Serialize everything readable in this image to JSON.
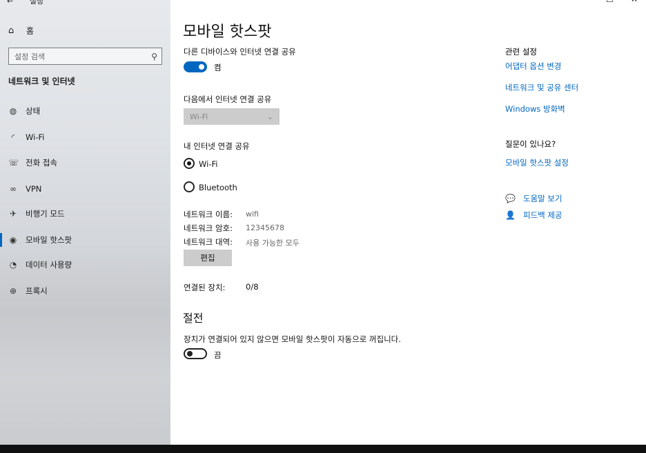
{
  "window": {
    "back_arrow": "←",
    "title": "설정",
    "controls": {
      "minimize": "—",
      "maximize": "☐",
      "close": "✕"
    }
  },
  "sidebar": {
    "home": {
      "icon": "home-icon",
      "label": "홈"
    },
    "search_placeholder": "설정 검색",
    "section_title": "네트워크 및 인터넷",
    "items": [
      {
        "icon": "globe-status-icon",
        "label": "상태"
      },
      {
        "icon": "wifi-icon",
        "label": "Wi-Fi"
      },
      {
        "icon": "dialup-icon",
        "label": "전화 접속"
      },
      {
        "icon": "vpn-icon",
        "label": "VPN"
      },
      {
        "icon": "airplane-icon",
        "label": "비행기 모드"
      },
      {
        "icon": "hotspot-icon",
        "label": "모바일 핫스팟",
        "active": true
      },
      {
        "icon": "data-usage-icon",
        "label": "데이터 사용량"
      },
      {
        "icon": "proxy-globe-icon",
        "label": "프록시"
      }
    ]
  },
  "main": {
    "title": "모바일 핫스팟",
    "share_label": "다른 디바이스와 인터넷 연결 공유",
    "share_toggle_state": "켬",
    "share_from_label": "다음에서 인터넷 연결 공유",
    "share_from_value": "Wi-Fi",
    "share_over_label": "내 인터넷 연결 공유",
    "options": [
      {
        "label": "Wi-Fi",
        "selected": true
      },
      {
        "label": "Bluetooth",
        "selected": false
      }
    ],
    "network_name_label": "네트워크 이름:",
    "network_name_value": "wifi",
    "network_password_label": "네트워크 암호:",
    "network_password_value": "12345678",
    "network_band_label": "네트워크 대역:",
    "network_band_value": "사용 가능한 모두",
    "edit_button": "편집",
    "connected_label": "연결된 장치:",
    "connected_value": "0/8",
    "power_heading": "절전",
    "power_desc": "장치가 연결되어 있지 않으면 모바일 핫스팟이 자동으로 꺼집니다.",
    "power_toggle_state": "끔"
  },
  "related": {
    "title": "관련 설정",
    "links": [
      "어댑터 옵션 변경",
      "네트워크 및 공유 센터",
      "Windows 방화벽"
    ],
    "question_title": "질문이 있나요?",
    "question_link": "모바일 핫스팟 설정",
    "help": [
      {
        "icon": "help-icon",
        "label": "도움말 보기"
      },
      {
        "icon": "feedback-icon",
        "label": "피드백 제공"
      }
    ]
  },
  "colors": {
    "accent": "#0067c0",
    "link": "#0067c0"
  }
}
